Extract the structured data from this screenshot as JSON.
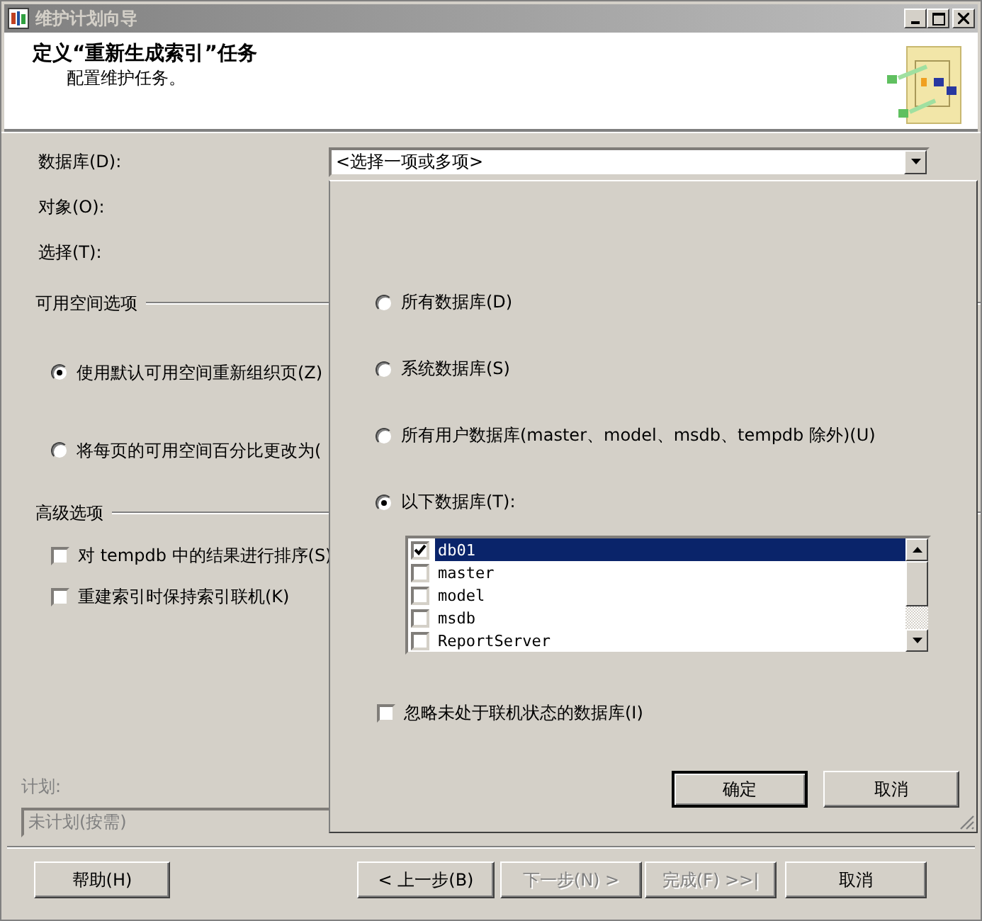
{
  "window": {
    "title": "维护计划向导"
  },
  "header": {
    "title": "定义“重新生成索引”任务",
    "subtitle": "配置维护任务。"
  },
  "form": {
    "fields": [
      {
        "label": "数据库(D):"
      },
      {
        "label": "对象(O):"
      },
      {
        "label": "选择(T):"
      }
    ],
    "database_dropdown": {
      "value": "<选择一项或多项>"
    }
  },
  "free_space": {
    "heading": "可用空间选项",
    "options": [
      {
        "label": "使用默认可用空间重新组织页(Z)",
        "selected": true
      },
      {
        "label": "将每页的可用空间百分比更改为(",
        "selected": false
      }
    ]
  },
  "advanced": {
    "heading": "高级选项",
    "options": [
      {
        "label": "对 tempdb 中的结果进行排序(S)",
        "checked": false
      },
      {
        "label": "重建索引时保持索引联机(K)",
        "checked": false
      }
    ]
  },
  "schedule": {
    "label": "计划:",
    "value": "未计划(按需)",
    "disabled": true
  },
  "popup": {
    "options": [
      {
        "label": "所有数据库(D)",
        "selected": false
      },
      {
        "label": "系统数据库(S)",
        "selected": false
      },
      {
        "label": "所有用户数据库(master、model、msdb、tempdb 除外)(U)",
        "selected": false
      },
      {
        "label": "以下数据库(T):",
        "selected": true
      }
    ],
    "databases": [
      {
        "name": "db01",
        "checked": true,
        "selected": true
      },
      {
        "name": "master",
        "checked": false,
        "selected": false
      },
      {
        "name": "model",
        "checked": false,
        "selected": false
      },
      {
        "name": "msdb",
        "checked": false,
        "selected": false
      },
      {
        "name": "ReportServer",
        "checked": false,
        "selected": false
      }
    ],
    "ignore_offline": {
      "label": "忽略未处于联机状态的数据库(I)",
      "checked": false
    },
    "buttons": [
      {
        "label": "确定",
        "default": true
      },
      {
        "label": "取消",
        "default": false
      }
    ]
  },
  "buttons": [
    {
      "label": "帮助(H)",
      "disabled": false
    },
    {
      "label": "< 上一步(B)",
      "disabled": false
    },
    {
      "label": "下一步(N) >",
      "disabled": true
    },
    {
      "label": "完成(F) >>|",
      "disabled": true
    },
    {
      "label": "取消",
      "disabled": false
    }
  ]
}
